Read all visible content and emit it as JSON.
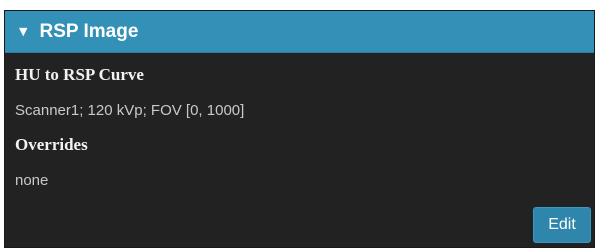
{
  "panel": {
    "title": "RSP Image",
    "caret_glyph": "▼",
    "header_color": "#3391b8",
    "body_color": "#222222"
  },
  "sections": {
    "curve": {
      "heading": "HU to RSP Curve",
      "value": "Scanner1; 120 kVp; FOV [0, 1000]"
    },
    "overrides": {
      "heading": "Overrides",
      "value": "none"
    }
  },
  "actions": {
    "edit_label": "Edit"
  }
}
